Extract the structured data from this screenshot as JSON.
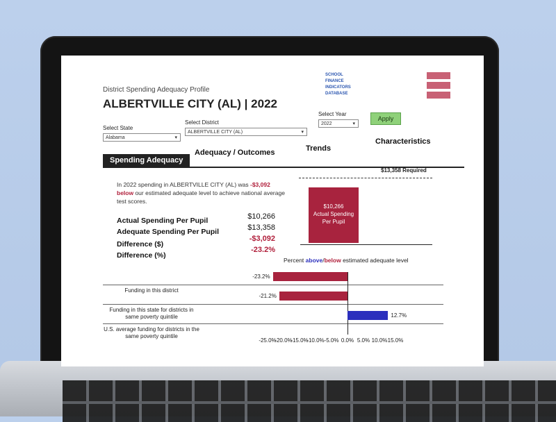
{
  "header": {
    "subtitle": "District Spending Adequacy Profile",
    "title": "ALBERTVILLE CITY (AL) | 2022",
    "logo_text": [
      "SCHOOL",
      "FINANCE",
      "INDICATORS",
      "DATABASE"
    ]
  },
  "controls": {
    "state_label": "Select State",
    "state_value": "Alabama",
    "district_label": "Select District",
    "district_value": "ALBERTVILLE CITY (AL)",
    "year_label": "Select Year",
    "year_value": "2022",
    "apply_label": "Apply"
  },
  "tabs": [
    {
      "label": "Spending Adequacy",
      "active": true
    },
    {
      "label": "Adequacy / Outcomes",
      "active": false
    },
    {
      "label": "Trends",
      "active": false
    },
    {
      "label": "Characteristics",
      "active": false
    }
  ],
  "summary": {
    "pre": "In 2022 spending in ALBERTVILLE CITY (AL) was ",
    "highlight": "-$3,092 below",
    "post": " our estimated adequate level to achieve national average test scores."
  },
  "metrics": [
    {
      "label": "Actual Spending Per Pupil",
      "value": "$10,266",
      "highlight": false
    },
    {
      "label": "Adequate Spending Per Pupil",
      "value": "$13,358",
      "highlight": false
    },
    {
      "label": "Difference ($)",
      "value": "-$3,092",
      "highlight": true
    },
    {
      "label": "Difference (%)",
      "value": "-23.2%",
      "highlight": true
    }
  ],
  "spending_chart": {
    "required_label": "$13,358 Required",
    "bar_value": "$10,266",
    "bar_caption_1": "Actual Spending",
    "bar_caption_2": "Per Pupil",
    "bar_fraction_of_required": 0.7685,
    "bar_color": "#a8233e"
  },
  "chart_data": {
    "type": "bar",
    "orientation": "horizontal",
    "title_parts": [
      "Percent ",
      "above",
      "/",
      "below",
      " estimated adequate level"
    ],
    "categories": [
      "Funding in this district",
      "Funding in this state for districts in same poverty quintile",
      "U.S. average funding for districts in the same poverty quintile"
    ],
    "values": [
      -23.2,
      -21.2,
      12.7
    ],
    "value_labels": [
      "-23.2%",
      "-21.2%",
      "12.7%"
    ],
    "xlim": [
      -25,
      15
    ],
    "ticks": [
      "-25.0%",
      "-20.0%",
      "-15.0%",
      "-10.0%",
      "-5.0%",
      "0.0%",
      "5.0%",
      "10.0%",
      "15.0%"
    ],
    "colors": {
      "negative": "#a8233e",
      "positive": "#2b2fbd"
    }
  }
}
